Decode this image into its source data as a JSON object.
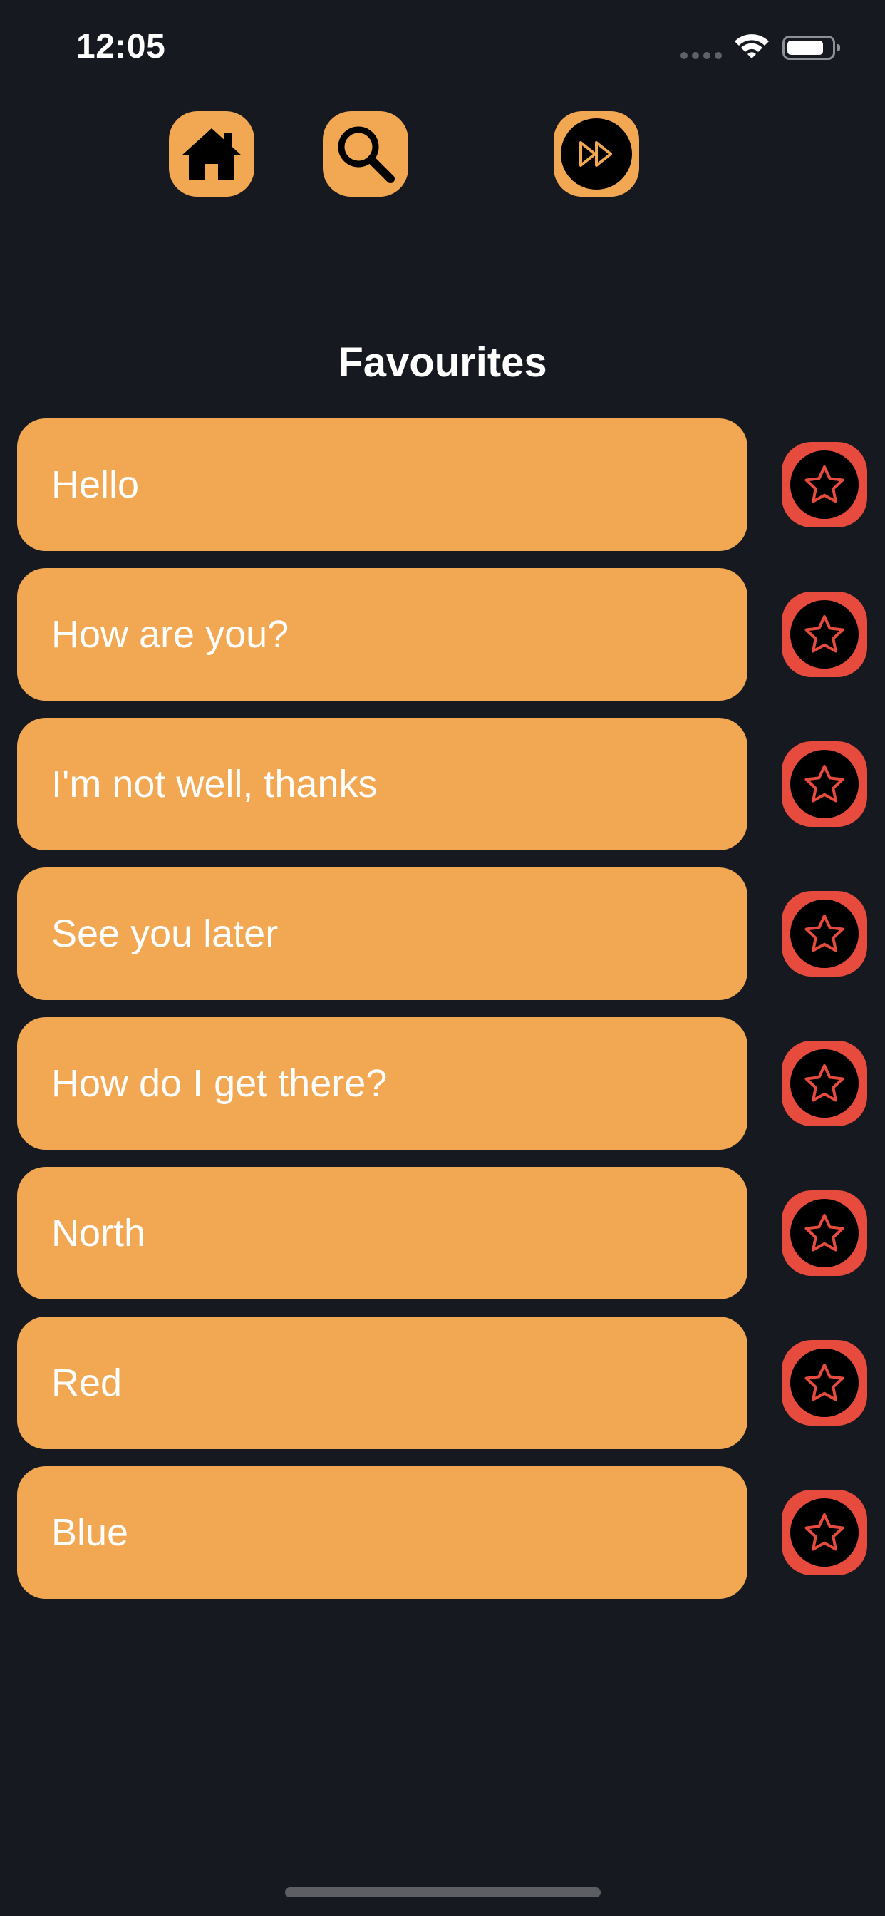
{
  "status_bar": {
    "time": "12:05"
  },
  "nav": {
    "home": {
      "icon": "home-icon"
    },
    "search": {
      "icon": "search-icon"
    },
    "fast_forward": {
      "icon": "fast-forward-icon"
    }
  },
  "page": {
    "title": "Favourites"
  },
  "favourites": [
    {
      "text": "Hello",
      "favourited": true
    },
    {
      "text": "How are you?",
      "favourited": true
    },
    {
      "text": "I'm not well, thanks",
      "favourited": true
    },
    {
      "text": "See you later",
      "favourited": true
    },
    {
      "text": "How do I get there?",
      "favourited": true
    },
    {
      "text": "North",
      "favourited": true
    },
    {
      "text": "Red",
      "favourited": true
    },
    {
      "text": "Blue",
      "favourited": true
    }
  ],
  "colors": {
    "background": "#161920",
    "accent_orange": "#f2a852",
    "favourite_red": "#e64b3d",
    "text": "#ffffff"
  }
}
